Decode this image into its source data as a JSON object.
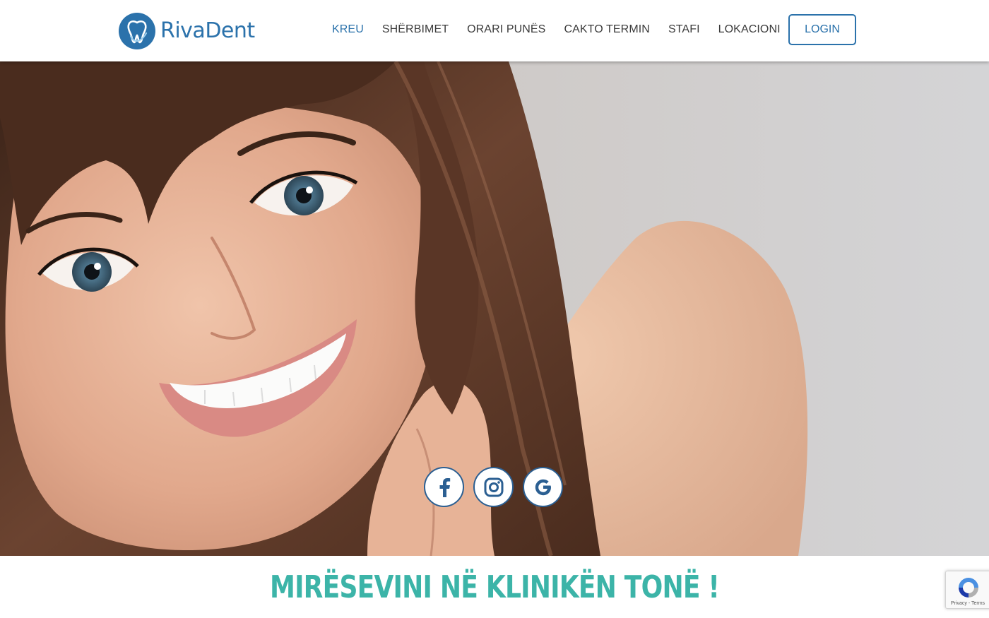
{
  "brand": {
    "name": "RivaDent"
  },
  "nav": {
    "items": [
      {
        "label": "KREU",
        "active": true
      },
      {
        "label": "SHËRBIMET",
        "active": false
      },
      {
        "label": "ORARI PUNËS",
        "active": false
      },
      {
        "label": "CAKTO TERMIN",
        "active": false
      },
      {
        "label": "STAFI",
        "active": false
      },
      {
        "label": "LOKACIONI",
        "active": false
      }
    ],
    "login_label": "LOGIN"
  },
  "hero": {
    "image_subject": "smiling woman portrait",
    "social": [
      {
        "icon": "facebook-icon"
      },
      {
        "icon": "instagram-icon"
      },
      {
        "icon": "google-icon"
      }
    ]
  },
  "welcome": {
    "title": "MIRËSEVINI NË KLINIKËN TONË !"
  },
  "recaptcha": {
    "privacy": "Privacy",
    "separator": " - ",
    "terms": "Terms"
  },
  "colors": {
    "brand_blue": "#2b72ab",
    "accent_teal": "#3cb4a8",
    "nav_text": "#3b3b3b"
  }
}
